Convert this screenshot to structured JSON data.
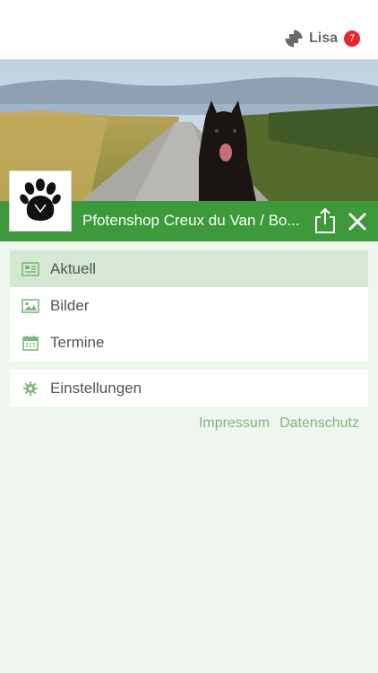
{
  "header": {
    "user_name": "Lisa",
    "notification_count": "7",
    "icons": {
      "brand": "checkered-logo-icon"
    }
  },
  "shop": {
    "title": "Pfotenshop Creux du Van / Bo...",
    "logo": "paw-logo",
    "hero_image": "dog-on-country-road-photo",
    "share_icon": "share-icon",
    "close_icon": "close-icon"
  },
  "menu": {
    "items": [
      {
        "label": "Aktuell",
        "icon": "newspaper-icon",
        "active": true
      },
      {
        "label": "Bilder",
        "icon": "image-icon",
        "active": false
      },
      {
        "label": "Termine",
        "icon": "calendar-icon",
        "active": false
      }
    ],
    "settings": {
      "label": "Einstellungen",
      "icon": "gear-icon"
    }
  },
  "footer_links": {
    "impressum": "Impressum",
    "datenschutz": "Datenschutz"
  },
  "colors": {
    "brand_green": "#3d9a3a",
    "active_bg": "#d5e8d3",
    "page_bg": "#eff6ee",
    "link_green": "#7fb77e",
    "badge_red": "#e3262f"
  }
}
